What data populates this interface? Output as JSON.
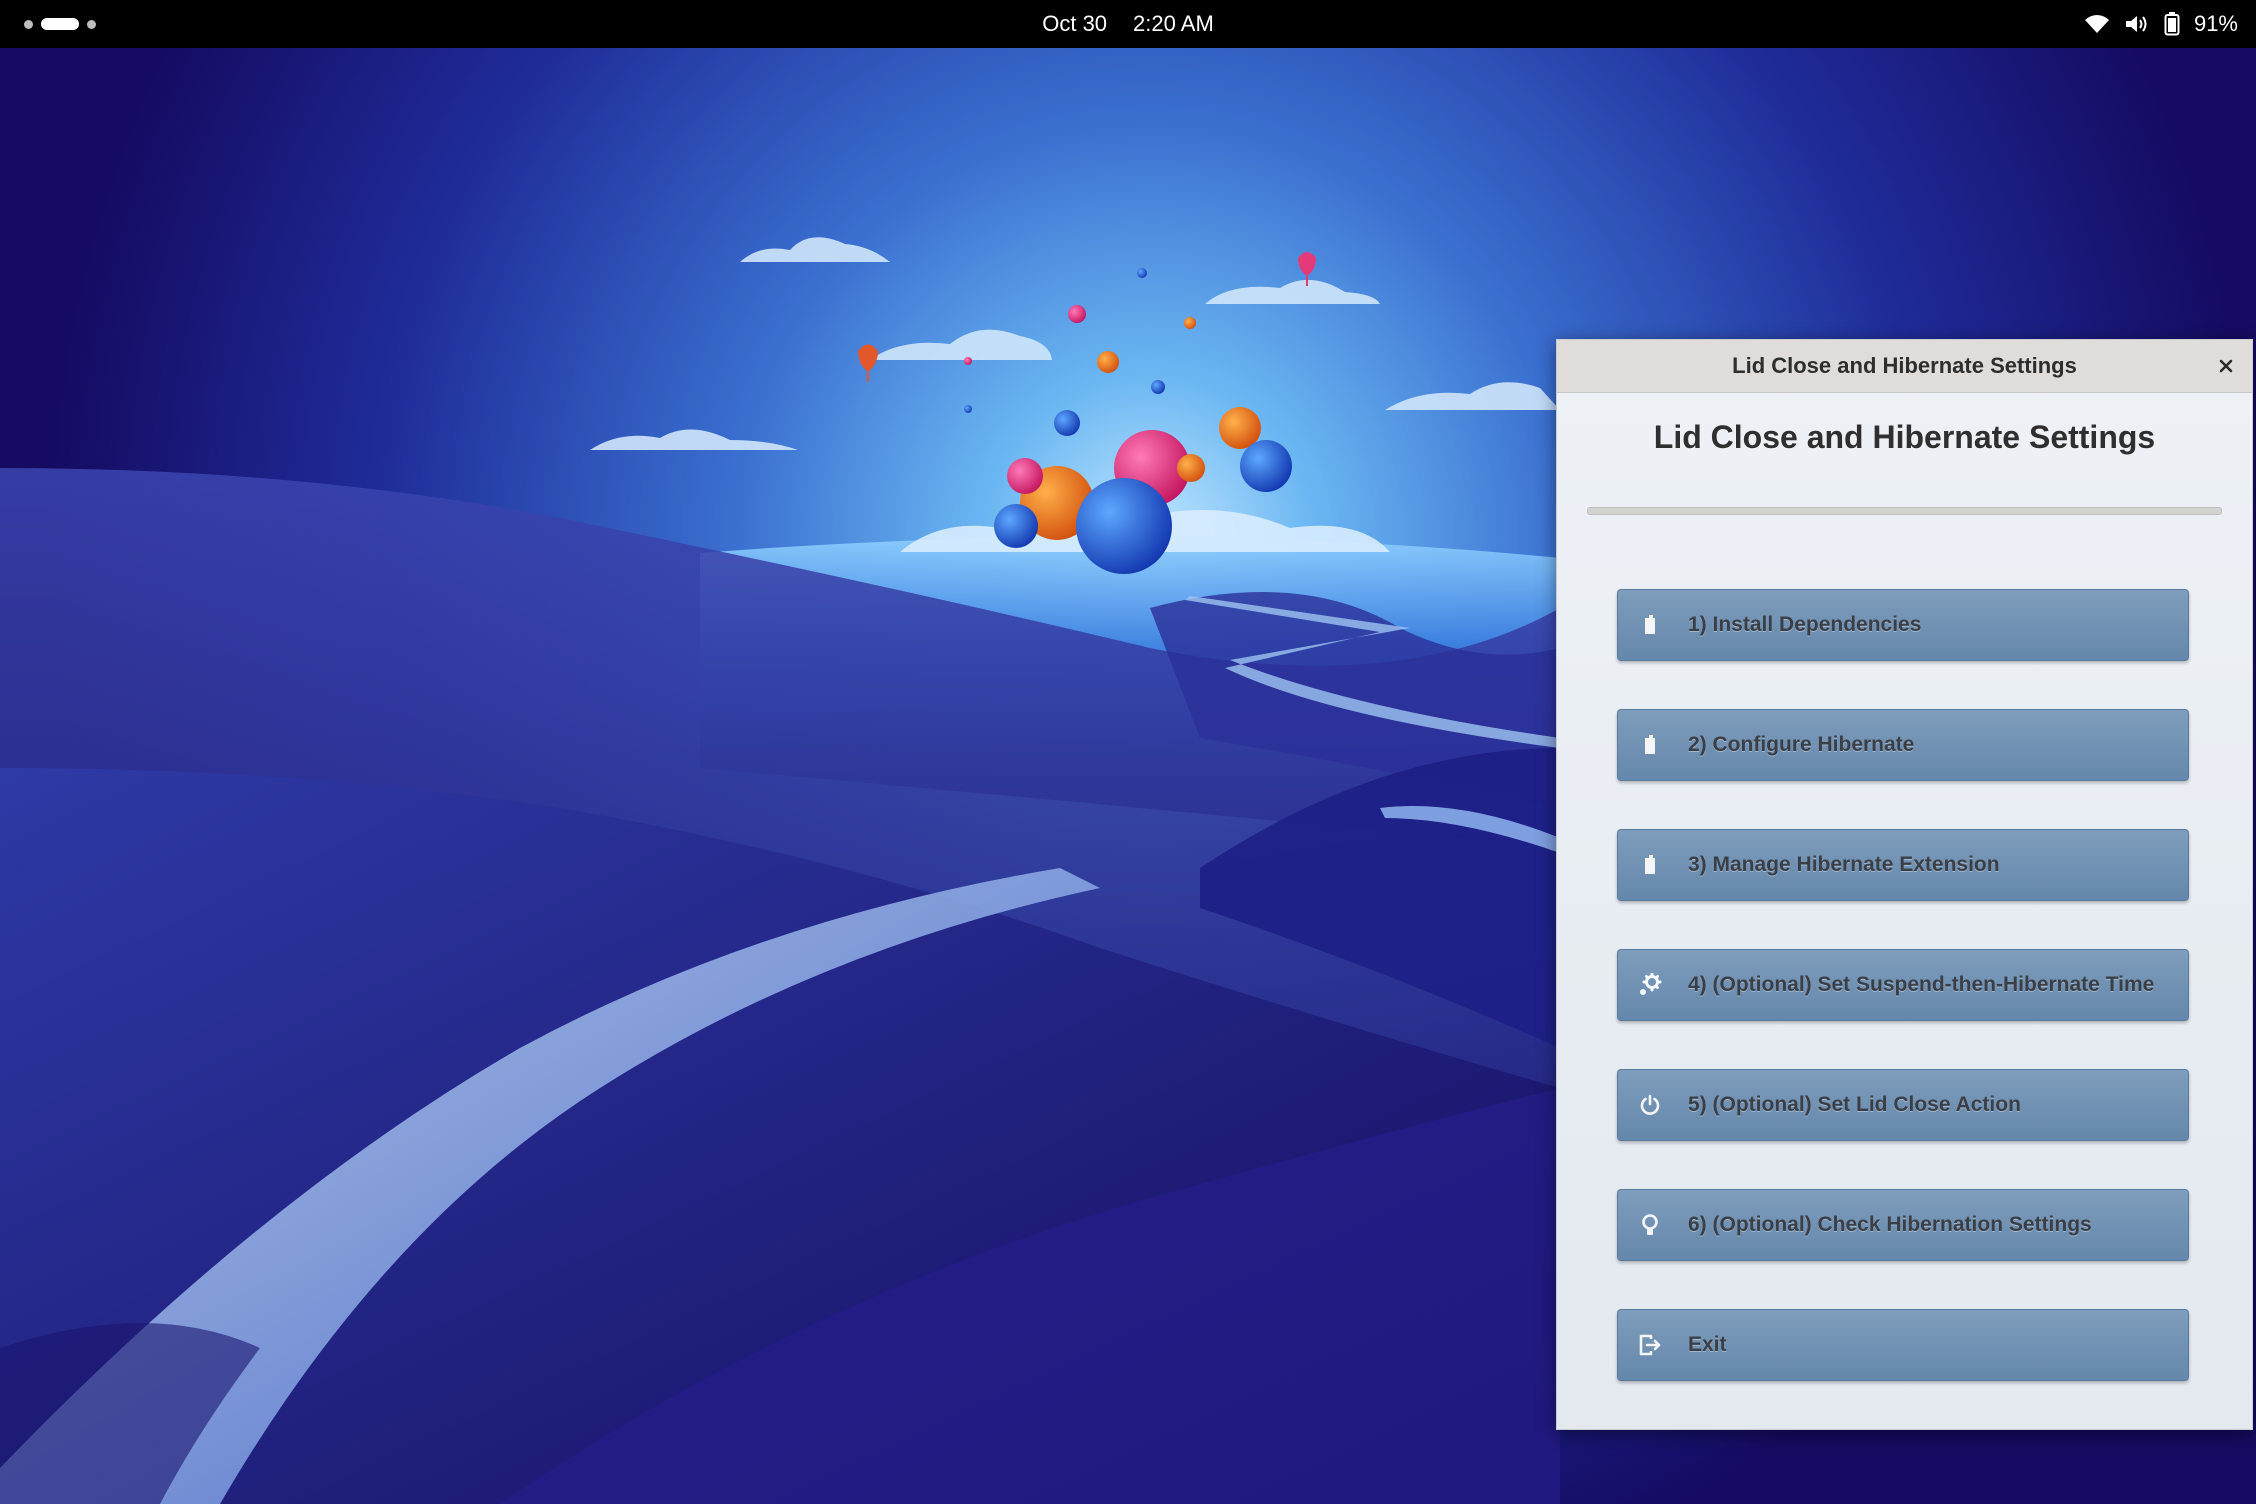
{
  "topbar": {
    "date": "Oct 30",
    "time": "2:20 AM",
    "battery": "91%",
    "icons": [
      "wifi-icon",
      "volume-icon",
      "battery-icon"
    ]
  },
  "dialog": {
    "window_title": "Lid Close and Hibernate Settings",
    "heading": "Lid Close and Hibernate Settings",
    "close_glyph": "✕",
    "buttons": [
      {
        "label": "1) Install Dependencies",
        "icon": "package-icon"
      },
      {
        "label": "2) Configure Hibernate",
        "icon": "package-icon"
      },
      {
        "label": "3) Manage Hibernate Extension",
        "icon": "package-icon"
      },
      {
        "label": "4) (Optional) Set Suspend-then-Hibernate Time",
        "icon": "gear-icon"
      },
      {
        "label": "5) (Optional) Set Lid Close Action",
        "icon": "power-icon"
      },
      {
        "label": "6) (Optional) Check Hibernation Settings",
        "icon": "lightbulb-icon"
      },
      {
        "label": "Exit",
        "icon": "exit-icon"
      }
    ]
  },
  "colors": {
    "button": "#6f8fb2",
    "wallpaper_deep": "#150b62",
    "wallpaper_glow": "#6ab6f2"
  }
}
